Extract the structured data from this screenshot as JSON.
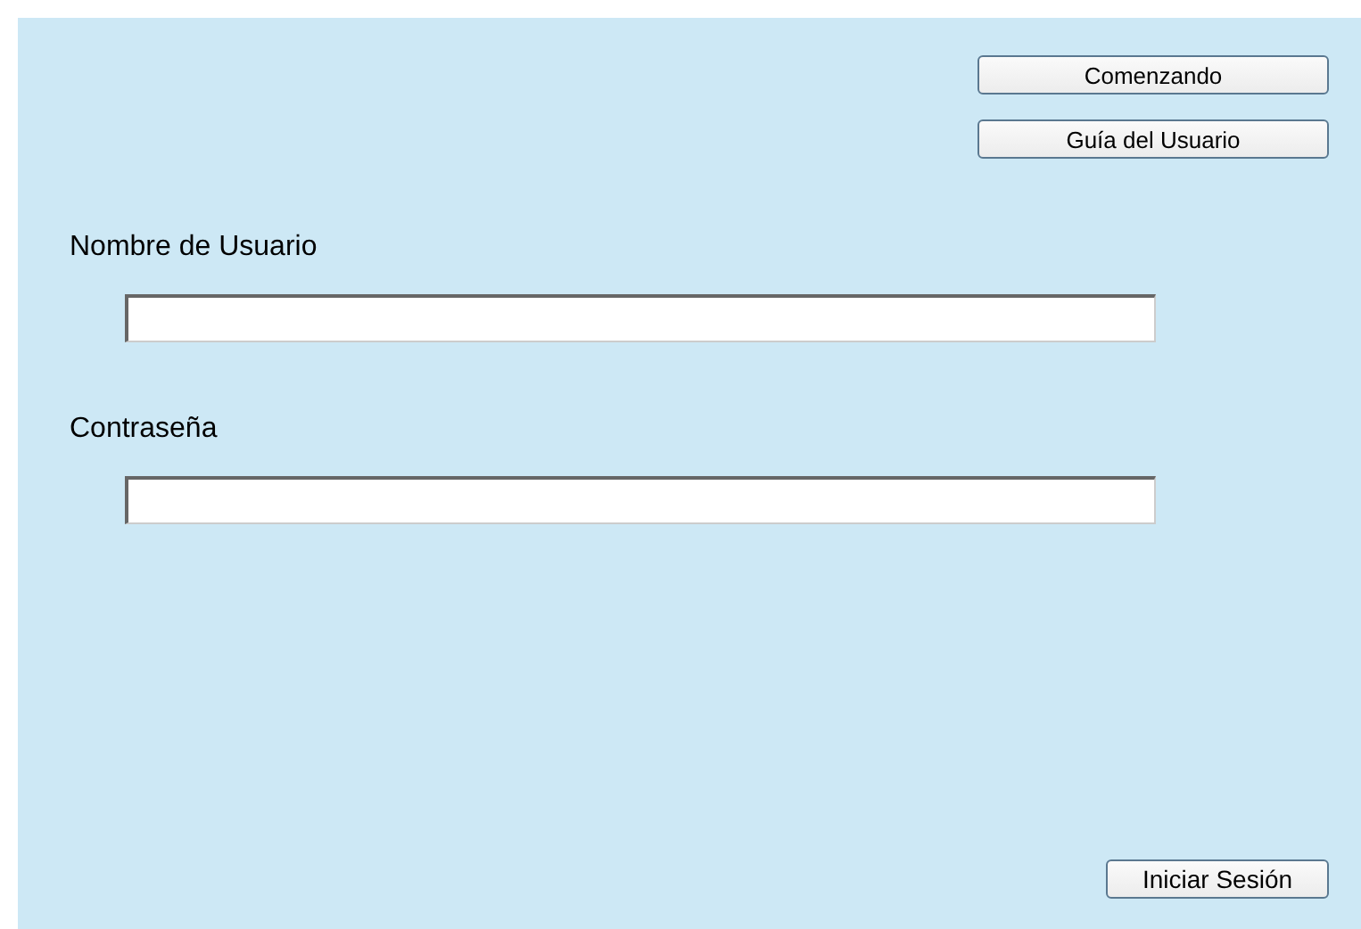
{
  "links": [
    {
      "label": "Comenzando"
    },
    {
      "label": "Guía del Usuario"
    }
  ],
  "fields": [
    {
      "label": "Nombre de Usuario"
    },
    {
      "label": "Contraseña"
    }
  ],
  "submit": {
    "label": "Iniciar Sesión"
  }
}
